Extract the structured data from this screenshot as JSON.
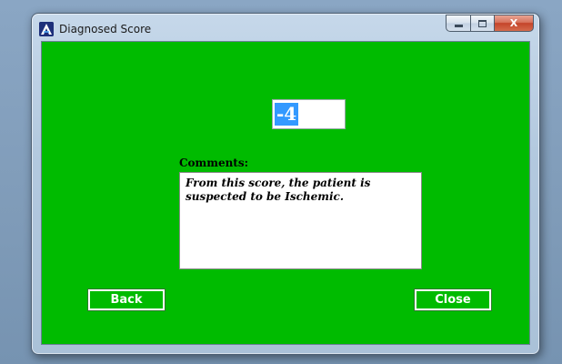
{
  "window": {
    "title": "Diagnosed Score",
    "app_icon": "app-logo-icon",
    "caption_buttons": {
      "minimize_icon": "minimize-icon",
      "maximize_icon": "maximize-icon",
      "close_glyph": "X"
    }
  },
  "score": {
    "value": "-4"
  },
  "comments": {
    "label": "Comments:",
    "text": "From this score, the patient is suspected to be Ischemic."
  },
  "buttons": {
    "back_label": "Back",
    "close_label": "Close"
  },
  "colors": {
    "client_background": "#00bb00",
    "selection_highlight": "#3399ff",
    "button_text": "#ffffff",
    "close_caption": "#c4442a"
  }
}
